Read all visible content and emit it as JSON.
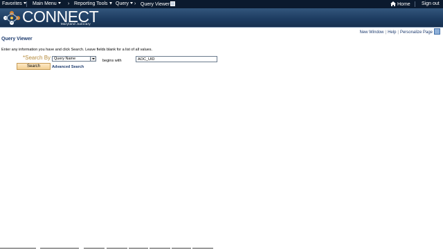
{
  "nav": {
    "favorites": "Favorites",
    "main_menu": "Main Menu",
    "chevron": "›",
    "reporting_tools": "Reporting Tools",
    "query": "Query",
    "query_viewer": "Query Viewer",
    "home": "Home",
    "sign_out": "Sign out"
  },
  "banner": {
    "logo_text": "CONNECT",
    "logo_subtext": "Maryland Judiciary"
  },
  "page_links": {
    "new_window": "New Window",
    "help": "Help",
    "personalize": "Personalize Page",
    "separator": "|"
  },
  "page": {
    "title": "Query Viewer",
    "instructions": "Enter any information you have and click Search. Leave fields blank for a list of all values."
  },
  "search_form": {
    "required_marker": "*",
    "search_by_label": "Search By",
    "search_by_selected": "Query Name",
    "operator_label": "begins with",
    "value": "AOC_UID",
    "search_button": "Search",
    "advanced_search": "Advanced Search"
  },
  "colors": {
    "nav_bg": "#0b1a2e",
    "banner_bg": "#1e3d62",
    "link_blue": "#1c3a6e",
    "label_gold": "#b58a3a",
    "button_fill": "#f3cf93"
  }
}
